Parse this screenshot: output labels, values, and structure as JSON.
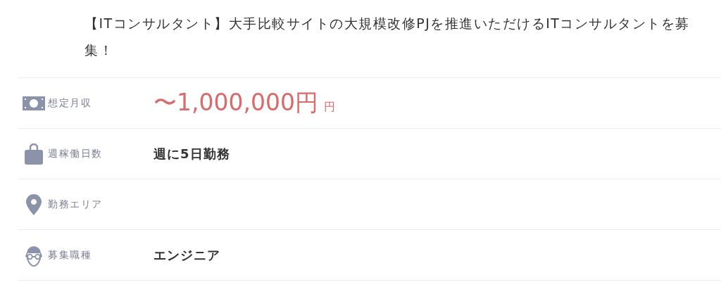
{
  "title": "【ITコンサルタント】大手比較サイトの大規模改修PJを推進いただけるITコンサルタントを募集！",
  "rows": [
    {
      "label": "想定月収",
      "kind": "salary",
      "value": "〜1,000,000円",
      "unit": "円"
    },
    {
      "label": "週稼働日数",
      "kind": "workdays",
      "value": "週に5日勤務"
    },
    {
      "label": "勤務エリア",
      "kind": "area"
    },
    {
      "label": "募集職種",
      "kind": "position",
      "value": "エンジニア"
    }
  ]
}
